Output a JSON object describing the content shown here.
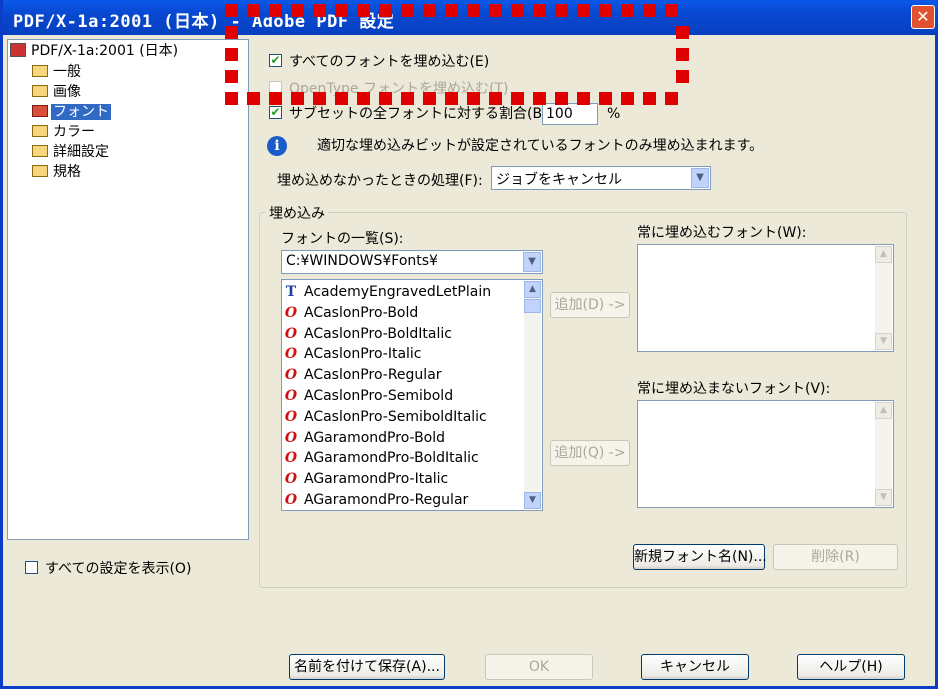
{
  "window": {
    "title": "PDF/X-1a:2001 (日本) - Adobe PDF 設定",
    "close_glyph": "✕"
  },
  "tree": {
    "root": "PDF/X-1a:2001 (日本)",
    "items": [
      {
        "label": "一般",
        "selected": false
      },
      {
        "label": "画像",
        "selected": false
      },
      {
        "label": "フォント",
        "selected": true
      },
      {
        "label": "カラー",
        "selected": false
      },
      {
        "label": "詳細設定",
        "selected": false
      },
      {
        "label": "規格",
        "selected": false
      }
    ]
  },
  "show_all_settings": {
    "label": "すべての設定を表示(O)",
    "checked": false
  },
  "options": {
    "embed_all": {
      "label": "すべてのフォントを埋め込む(E)",
      "checked": true
    },
    "embed_opentype": {
      "label": "OpenType フォントを埋め込む(T)",
      "checked": false,
      "disabled": true
    },
    "subset": {
      "label": "サブセットの全フォントに対する割合(B):",
      "checked": true,
      "value": "100",
      "unit": "%"
    },
    "info": "適切な埋め込みビットが設定されているフォントのみ埋め込まれます。",
    "fail_action": {
      "label": "埋め込めなかったときの処理(F):",
      "value": "ジョブをキャンセル"
    }
  },
  "embedding": {
    "title": "埋め込み",
    "font_list_label": "フォントの一覧(S):",
    "folder": "C:¥WINDOWS¥Fonts¥",
    "fonts": [
      {
        "name": "AcademyEngravedLetPlain",
        "type": "truetype",
        "glyph": "T"
      },
      {
        "name": "ACaslonPro-Bold",
        "type": "opentype",
        "glyph": "O"
      },
      {
        "name": "ACaslonPro-BoldItalic",
        "type": "opentype",
        "glyph": "O"
      },
      {
        "name": "ACaslonPro-Italic",
        "type": "opentype",
        "glyph": "O"
      },
      {
        "name": "ACaslonPro-Regular",
        "type": "opentype",
        "glyph": "O"
      },
      {
        "name": "ACaslonPro-Semibold",
        "type": "opentype",
        "glyph": "O"
      },
      {
        "name": "ACaslonPro-SemiboldItalic",
        "type": "opentype",
        "glyph": "O"
      },
      {
        "name": "AGaramondPro-Bold",
        "type": "opentype",
        "glyph": "O"
      },
      {
        "name": "AGaramondPro-BoldItalic",
        "type": "opentype",
        "glyph": "O"
      },
      {
        "name": "AGaramondPro-Italic",
        "type": "opentype",
        "glyph": "O"
      },
      {
        "name": "AGaramondPro-Regular",
        "type": "opentype",
        "glyph": "O"
      }
    ],
    "always_embed_label": "常に埋め込むフォント(W):",
    "never_embed_label": "常に埋め込まないフォント(V):",
    "add_embed_button": "追加(D) ->",
    "add_never_button": "追加(Q) ->",
    "new_font_button": "新規フォント名(N)...",
    "delete_button": "削除(R)"
  },
  "footer": {
    "save_as": "名前を付けて保存(A)...",
    "ok": "OK",
    "cancel": "キャンセル",
    "help": "ヘルプ(H)"
  },
  "glyphs": {
    "check": "✔",
    "down": "▼",
    "up": "▲",
    "info": "i"
  },
  "colors": {
    "titlebar": "#0a58e8",
    "dotted_overlay": "#e00000",
    "selection": "#316ac5"
  }
}
